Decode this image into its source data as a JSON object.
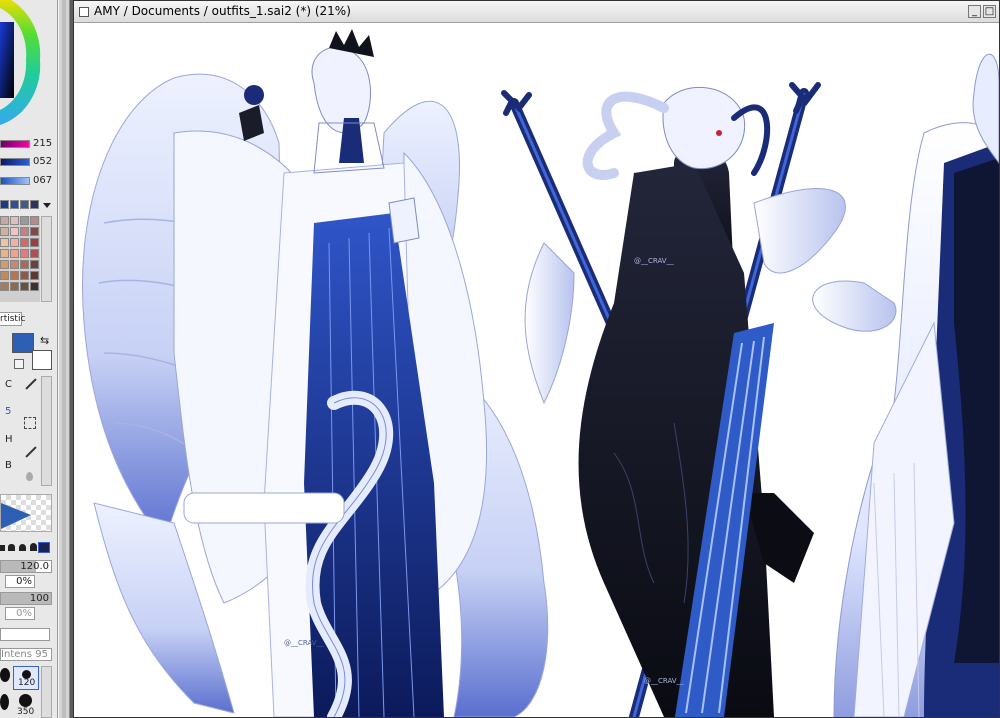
{
  "document": {
    "title": "AMY / Documents / outfits_1.sai2 (*) (21%)",
    "controls": {
      "minimize": "_",
      "maximize": "□"
    }
  },
  "color_panel": {
    "sliders": [
      {
        "value": "215",
        "color": "#e0007a"
      },
      {
        "value": "052",
        "color": "#1b3fa0"
      },
      {
        "value": "067",
        "color": "#3b6fd0"
      }
    ],
    "primary_color": "#2d5fb5"
  },
  "tool_panel": {
    "tab_label": "rtistic",
    "shortcut_keys": [
      "C",
      "5",
      "H",
      "B"
    ],
    "values": {
      "size": "120.0",
      "min_size": "0%",
      "density": "100",
      "min_density": "0%",
      "intensity_label": "Intens",
      "intensity_value": "95"
    },
    "brush_sizes": [
      "120",
      "350"
    ]
  },
  "artwork": {
    "watermark": "@__CRAV__",
    "palette": {
      "navy": "#1a2b78",
      "blue": "#3257c4",
      "ice": "#dfe6ff",
      "black": "#15161e"
    }
  }
}
